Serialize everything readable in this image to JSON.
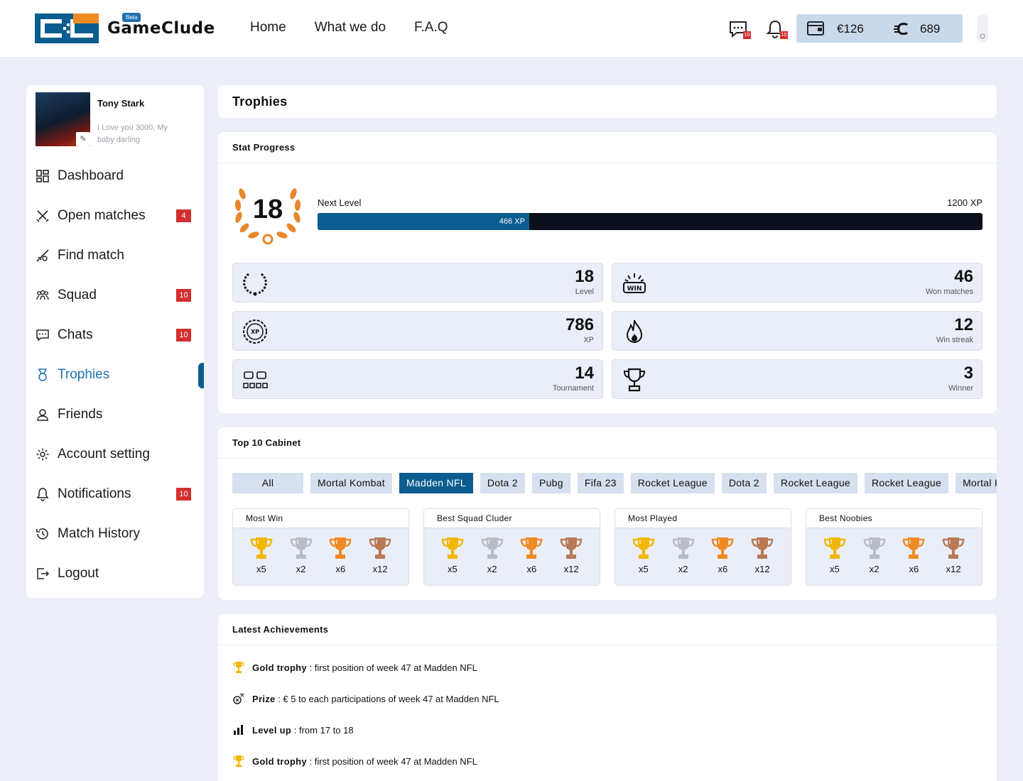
{
  "header": {
    "brand": "GameClude",
    "beta": "Beta",
    "nav": [
      "Home",
      "What we do",
      "F.A.Q"
    ],
    "chat_badge": "10",
    "notif_badge": "10",
    "wallet_money": "€126",
    "wallet_coins": "689"
  },
  "profile": {
    "name": "Tony Stark",
    "bio": "I Love you 3000, My baby darling"
  },
  "sidebar": {
    "items": [
      {
        "label": "Dashboard",
        "badge": ""
      },
      {
        "label": "Open matches",
        "badge": "4"
      },
      {
        "label": "Find match",
        "badge": ""
      },
      {
        "label": "Squad",
        "badge": "10"
      },
      {
        "label": "Chats",
        "badge": "10"
      },
      {
        "label": "Trophies",
        "badge": ""
      },
      {
        "label": "Friends",
        "badge": ""
      },
      {
        "label": "Account setting",
        "badge": ""
      },
      {
        "label": "Notifications",
        "badge": "10"
      },
      {
        "label": "Match History",
        "badge": ""
      },
      {
        "label": "Logout",
        "badge": ""
      }
    ]
  },
  "page": {
    "title": "Trophies"
  },
  "stat_progress": {
    "title": "Stat Progress",
    "level": "18",
    "next_level_label": "Next Level",
    "max_xp": "1200 XP",
    "current_xp": "466 XP",
    "progress_fraction": 0.3183,
    "stats": [
      {
        "value": "18",
        "label": "Level"
      },
      {
        "value": "46",
        "label": "Won matches"
      },
      {
        "value": "786",
        "label": "XP"
      },
      {
        "value": "12",
        "label": "Win streak"
      },
      {
        "value": "14",
        "label": "Tournament"
      },
      {
        "value": "3",
        "label": "Winner"
      }
    ]
  },
  "cabinet": {
    "title": "Top 10 Cabinet",
    "tabs": [
      "All",
      "Mortal Kombat",
      "Madden NFL",
      "Dota 2",
      "Pubg",
      "Fifa 23",
      "Rocket League",
      "Dota 2",
      "Rocket League",
      "Rocket League",
      "Mortal Kombat"
    ],
    "selected_tab": "Madden NFL",
    "boxes": [
      {
        "title": "Most Win",
        "counts": [
          "x5",
          "x2",
          "x6",
          "x12"
        ]
      },
      {
        "title": "Best Squad Cluder",
        "counts": [
          "x5",
          "x2",
          "x6",
          "x12"
        ]
      },
      {
        "title": "Most Played",
        "counts": [
          "x5",
          "x2",
          "x6",
          "x12"
        ]
      },
      {
        "title": "Best Noobies",
        "counts": [
          "x5",
          "x2",
          "x6",
          "x12"
        ]
      }
    ],
    "trophy_colors": [
      "#f2b705",
      "#b8bcc4",
      "#f08a24",
      "#b87a56"
    ]
  },
  "achievements": {
    "title": "Latest Achievements",
    "items": [
      {
        "label": "Gold trophy",
        "text": " : first position of week 47 at Madden NFL",
        "icon": "trophy-icon"
      },
      {
        "label": "Prize",
        "text": " : € 5 to each participations of week 47 at Madden NFL",
        "icon": "prize-icon"
      },
      {
        "label": "Level up",
        "text": " : from 17 to 18",
        "icon": "bars-icon"
      },
      {
        "label": "Gold trophy",
        "text": " : first position of week 47 at Madden NFL",
        "icon": "trophy-icon"
      }
    ]
  }
}
